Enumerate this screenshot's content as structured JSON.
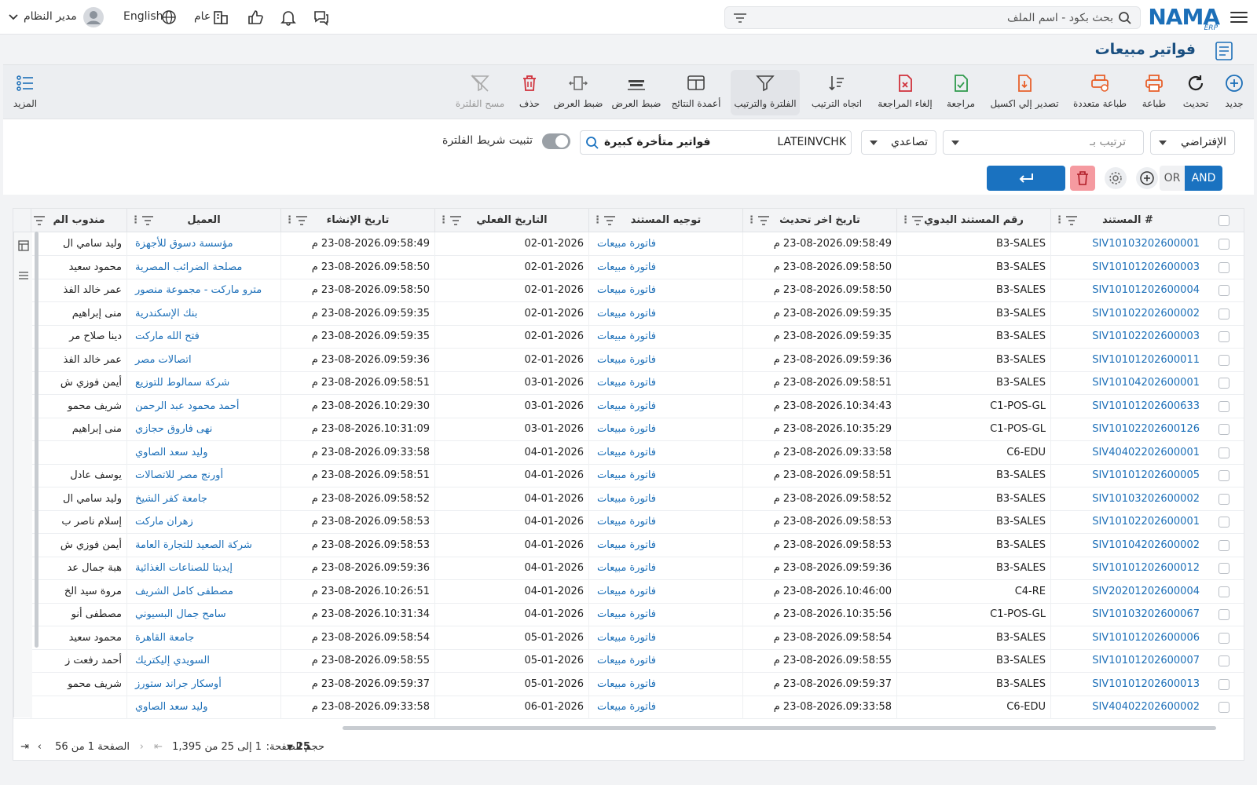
{
  "topbar": {
    "logo": "NAMA",
    "logo_sub": "ERP",
    "search_placeholder": "بحث بكود - اسم الملف",
    "user": "مدير النظام",
    "language": "English",
    "branch": "عام",
    "icons": [
      "menu-icon",
      "search-icon",
      "filter-icon",
      "chat-icon",
      "bell-icon",
      "thumbs-up-icon",
      "building-icon",
      "globe-icon",
      "avatar-icon",
      "chevron-down-icon"
    ]
  },
  "page": {
    "title": "فواتير مبيعات"
  },
  "toolbar": {
    "new": "جديد",
    "refresh": "تحديث",
    "print": "طباعة",
    "multi_print": "طباعة متعددة",
    "export_excel": "تصدير إلي اكسيل",
    "review": "مراجعة",
    "cancel_review": "إلغاء المراجعة",
    "sort_direction": "اتجاه الترتيب",
    "filter_sort": "الفلترة والترتيب",
    "result_columns": "أعمدة النتائج",
    "fit_width1": "ضبط العرض",
    "fit_width2": "ضبط العرض",
    "delete": "حذف",
    "clear_filter": "مسح الفلترة",
    "more": "المزيد"
  },
  "filters": {
    "default_view": "الإفتراضي",
    "sort_by_placeholder": "ترتيب بـ",
    "direction": "تصاعدي",
    "saved_filter_name": "فواتير متأخرة كبيرة",
    "saved_filter_code": "LATEINVCHK",
    "pin_label": "تثبيت شريط الفلترة",
    "and": "AND",
    "or": "OR"
  },
  "grid": {
    "columns": [
      "# المستند",
      "رقم المستند اليدوي",
      "تاريخ اخر تحديث",
      "توجيه المستند",
      "التاريخ الفعلي",
      "تاريخ الإنشاء",
      "العميل",
      "مندوب الم"
    ],
    "rows": [
      {
        "doc": "SIV10103202600001",
        "manual": "B3-SALES",
        "updated": "23-08-2026.09:58:49 م",
        "type": "فاتورة مبيعات",
        "date": "02-01-2026",
        "created": "23-08-2026.09:58:49 م",
        "customer": "مؤسسة دسوق للأجهزة",
        "rep": "وليد سامي ال"
      },
      {
        "doc": "SIV10101202600003",
        "manual": "B3-SALES",
        "updated": "23-08-2026.09:58:50 م",
        "type": "فاتورة مبيعات",
        "date": "02-01-2026",
        "created": "23-08-2026.09:58:50 م",
        "customer": "مصلحة الضرائب المصرية",
        "rep": "محمود سعيد"
      },
      {
        "doc": "SIV10101202600004",
        "manual": "B3-SALES",
        "updated": "23-08-2026.09:58:50 م",
        "type": "فاتورة مبيعات",
        "date": "02-01-2026",
        "created": "23-08-2026.09:58:50 م",
        "customer": "مترو ماركت - مجموعة منصور",
        "rep": "عمر خالد الفذ"
      },
      {
        "doc": "SIV10102202600002",
        "manual": "B3-SALES",
        "updated": "23-08-2026.09:59:35 م",
        "type": "فاتورة مبيعات",
        "date": "02-01-2026",
        "created": "23-08-2026.09:59:35 م",
        "customer": "بنك الإسكندرية",
        "rep": "منى إبراهيم"
      },
      {
        "doc": "SIV10102202600003",
        "manual": "B3-SALES",
        "updated": "23-08-2026.09:59:35 م",
        "type": "فاتورة مبيعات",
        "date": "02-01-2026",
        "created": "23-08-2026.09:59:35 م",
        "customer": "فتح الله ماركت",
        "rep": "دينا صلاح مر"
      },
      {
        "doc": "SIV10101202600011",
        "manual": "B3-SALES",
        "updated": "23-08-2026.09:59:36 م",
        "type": "فاتورة مبيعات",
        "date": "02-01-2026",
        "created": "23-08-2026.09:59:36 م",
        "customer": "اتصالات مصر",
        "rep": "عمر خالد الفذ"
      },
      {
        "doc": "SIV10104202600001",
        "manual": "B3-SALES",
        "updated": "23-08-2026.09:58:51 م",
        "type": "فاتورة مبيعات",
        "date": "03-01-2026",
        "created": "23-08-2026.09:58:51 م",
        "customer": "شركة سمالوط للتوزيع",
        "rep": "أيمن فوزي ش"
      },
      {
        "doc": "SIV10101202600633",
        "manual": "C1-POS-GL",
        "updated": "23-08-2026.10:34:43 م",
        "type": "فاتورة مبيعات",
        "date": "03-01-2026",
        "created": "23-08-2026.10:29:30 م",
        "customer": "أحمد محمود عبد الرحمن",
        "rep": "شريف محمو"
      },
      {
        "doc": "SIV10102202600126",
        "manual": "C1-POS-GL",
        "updated": "23-08-2026.10:35:29 م",
        "type": "فاتورة مبيعات",
        "date": "03-01-2026",
        "created": "23-08-2026.10:31:09 م",
        "customer": "نهى فاروق حجازي",
        "rep": "منى إبراهيم"
      },
      {
        "doc": "SIV40402202600001",
        "manual": "C6-EDU",
        "updated": "23-08-2026.09:33:58 م",
        "type": "فاتورة مبيعات",
        "date": "04-01-2026",
        "created": "23-08-2026.09:33:58 م",
        "customer": "وليد سعد الصاوي",
        "rep": ""
      },
      {
        "doc": "SIV10101202600005",
        "manual": "B3-SALES",
        "updated": "23-08-2026.09:58:51 م",
        "type": "فاتورة مبيعات",
        "date": "04-01-2026",
        "created": "23-08-2026.09:58:51 م",
        "customer": "أورنج مصر للاتصالات",
        "rep": "يوسف عادل"
      },
      {
        "doc": "SIV10103202600002",
        "manual": "B3-SALES",
        "updated": "23-08-2026.09:58:52 م",
        "type": "فاتورة مبيعات",
        "date": "04-01-2026",
        "created": "23-08-2026.09:58:52 م",
        "customer": "جامعة كفر الشيخ",
        "rep": "وليد سامي ال"
      },
      {
        "doc": "SIV10102202600001",
        "manual": "B3-SALES",
        "updated": "23-08-2026.09:58:53 م",
        "type": "فاتورة مبيعات",
        "date": "04-01-2026",
        "created": "23-08-2026.09:58:53 م",
        "customer": "زهران ماركت",
        "rep": "إسلام ناصر ب"
      },
      {
        "doc": "SIV10104202600002",
        "manual": "B3-SALES",
        "updated": "23-08-2026.09:58:53 م",
        "type": "فاتورة مبيعات",
        "date": "04-01-2026",
        "created": "23-08-2026.09:58:53 م",
        "customer": "شركة الصعيد للتجارة العامة",
        "rep": "أيمن فوزي ش"
      },
      {
        "doc": "SIV10101202600012",
        "manual": "B3-SALES",
        "updated": "23-08-2026.09:59:36 م",
        "type": "فاتورة مبيعات",
        "date": "04-01-2026",
        "created": "23-08-2026.09:59:36 م",
        "customer": "إيديتا للصناعات الغذائية",
        "rep": "هبة جمال عد"
      },
      {
        "doc": "SIV20201202600004",
        "manual": "C4-RE",
        "updated": "23-08-2026.10:46:00 م",
        "type": "فاتورة مبيعات",
        "date": "04-01-2026",
        "created": "23-08-2026.10:26:51 م",
        "customer": "مصطفى كامل الشريف",
        "rep": "مروة سيد الخ"
      },
      {
        "doc": "SIV10103202600067",
        "manual": "C1-POS-GL",
        "updated": "23-08-2026.10:35:56 م",
        "type": "فاتورة مبيعات",
        "date": "04-01-2026",
        "created": "23-08-2026.10:31:34 م",
        "customer": "سامح جمال البسيوني",
        "rep": "مصطفى أنو"
      },
      {
        "doc": "SIV10101202600006",
        "manual": "B3-SALES",
        "updated": "23-08-2026.09:58:54 م",
        "type": "فاتورة مبيعات",
        "date": "05-01-2026",
        "created": "23-08-2026.09:58:54 م",
        "customer": "جامعة القاهرة",
        "rep": "محمود سعيد"
      },
      {
        "doc": "SIV10101202600007",
        "manual": "B3-SALES",
        "updated": "23-08-2026.09:58:55 م",
        "type": "فاتورة مبيعات",
        "date": "05-01-2026",
        "created": "23-08-2026.09:58:55 م",
        "customer": "السويدي إليكتريك",
        "rep": "أحمد رفعت ز"
      },
      {
        "doc": "SIV10101202600013",
        "manual": "B3-SALES",
        "updated": "23-08-2026.09:59:37 م",
        "type": "فاتورة مبيعات",
        "date": "05-01-2026",
        "created": "23-08-2026.09:59:37 م",
        "customer": "أوسكار جراند ستورز",
        "rep": "شريف محمو"
      },
      {
        "doc": "SIV40402202600002",
        "manual": "C6-EDU",
        "updated": "23-08-2026.09:33:58 م",
        "type": "فاتورة مبيعات",
        "date": "06-01-2026",
        "created": "23-08-2026.09:33:58 م",
        "customer": "وليد سعد الصاوي",
        "rep": ""
      }
    ]
  },
  "pager": {
    "page_size_label": "حجم الصفحة:",
    "page_size": "25",
    "range": "1 إلى 25 من 1,395",
    "page_info": "الصفحة 1 من 56"
  }
}
